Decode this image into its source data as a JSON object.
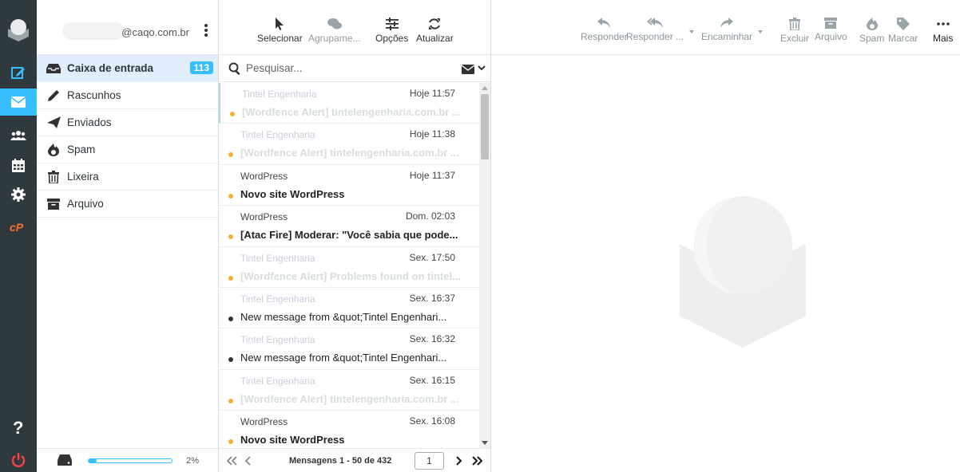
{
  "account": {
    "email": "@caqo.com.br"
  },
  "folders": [
    {
      "label": "Caixa de entrada",
      "icon": "inbox-icon",
      "count": "113",
      "selected": true
    },
    {
      "label": "Rascunhos",
      "icon": "pencil-icon"
    },
    {
      "label": "Enviados",
      "icon": "paper-plane-icon"
    },
    {
      "label": "Spam",
      "icon": "fire-icon"
    },
    {
      "label": "Lixeira",
      "icon": "trash-icon"
    },
    {
      "label": "Arquivo",
      "icon": "archive-icon"
    }
  ],
  "quota": {
    "percent_label": "2%",
    "fraction": 0.02
  },
  "list_toolbar": {
    "select": "Selecionar",
    "group": "Agrupame...",
    "options": "Opções",
    "refresh": "Atualizar"
  },
  "search": {
    "placeholder": "Pesquisar..."
  },
  "messages": [
    {
      "from": "Tintel Engenharia",
      "date": "Hoje 11:57",
      "subject": "[Wordfence Alert] tintelengenharia.com.br ...",
      "from_faint": true,
      "subject_faint": true,
      "dot": "yellow"
    },
    {
      "from": "Tintel Engenharia",
      "date": "Hoje 11:38",
      "subject": "[Wordfence Alert] tintelengenharia.com.br ...",
      "from_faint": true,
      "subject_faint": true,
      "dot": "yellow"
    },
    {
      "from": "WordPress",
      "date": "Hoje 11:37",
      "subject": "Novo site WordPress",
      "dot": "yellow",
      "bold": true
    },
    {
      "from": "WordPress",
      "date": "Dom. 02:03",
      "subject": "[Atac Fire] Moderar: \"Você sabia que pode...",
      "dot": "yellow",
      "bold": true
    },
    {
      "from": "Tintel Engenharia",
      "date": "Sex. 17:50",
      "subject": "[Wordfence Alert] Problems found on tintel...",
      "from_faint": true,
      "subject_faint": true,
      "dot": "yellow"
    },
    {
      "from": "Tintel Engenharia",
      "date": "Sex. 16:37",
      "subject": "New message from &quot;Tintel Engenhari...",
      "from_faint": true,
      "dot": "dark"
    },
    {
      "from": "Tintel Engenharia",
      "date": "Sex. 16:32",
      "subject": "New message from &quot;Tintel Engenhari...",
      "from_faint": true,
      "dot": "dark"
    },
    {
      "from": "Tintel Engenharia",
      "date": "Sex. 16:15",
      "subject": "[Wordfence Alert] tintelengenharia.com.br ...",
      "from_faint": true,
      "subject_faint": true,
      "dot": "yellow"
    },
    {
      "from": "WordPress",
      "date": "Sex. 16:08",
      "subject": "Novo site WordPress",
      "dot": "yellow",
      "bold": true
    }
  ],
  "pagination": {
    "label": "Mensagens 1 - 50 de 432",
    "page": "1"
  },
  "preview_toolbar": {
    "reply": "Responder",
    "reply_all": "Responder ...",
    "forward": "Encaminhar",
    "delete": "Excluir",
    "archive": "Arquivo",
    "spam": "Spam",
    "mark": "Marcar",
    "more": "Mais"
  },
  "colors": {
    "accent": "#37beff",
    "rail": "#2f3a3f",
    "unread_dot": "#f3b22e",
    "cpanel": "#ff6c2c",
    "logout": "#ff4040"
  }
}
